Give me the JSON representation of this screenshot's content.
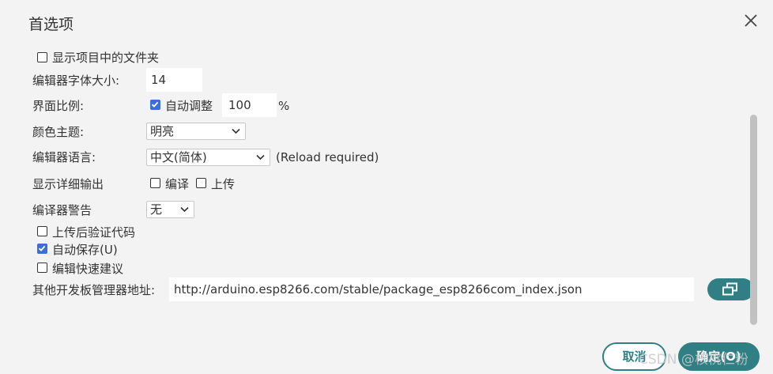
{
  "dialog": {
    "title": "首选项"
  },
  "settings": {
    "show_sketch_folder": {
      "label": "显示项目中的文件夹",
      "checked": false
    },
    "editor_font_size": {
      "label": "编辑器字体大小:",
      "value": "14"
    },
    "interface_scale": {
      "label": "界面比例:",
      "auto_label": "自动调整",
      "auto_checked": true,
      "value": "100",
      "unit": "%"
    },
    "theme": {
      "label": "颜色主题:",
      "value": "明亮"
    },
    "language": {
      "label": "编辑器语言:",
      "value": "中文(简体)",
      "note": "(Reload required)"
    },
    "verbose_output": {
      "label": "显示详细输出",
      "compile_label": "编译",
      "compile_checked": false,
      "upload_label": "上传",
      "upload_checked": false
    },
    "compiler_warnings": {
      "label": "编译器警告",
      "value": "无"
    },
    "verify_after_upload": {
      "label": "上传后验证代码",
      "checked": false
    },
    "auto_save": {
      "label": "自动保存(U)",
      "checked": true
    },
    "quick_suggestions": {
      "label": "编辑快速建议",
      "checked": false
    },
    "board_manager_urls": {
      "label": "其他开发板管理器地址:",
      "value": "http://arduino.esp8266.com/stable/package_esp8266com_index.json",
      "button_icon": "open-window-icon"
    }
  },
  "buttons": {
    "cancel": "取消",
    "ok": "确定(O)"
  },
  "watermark": "CSDN @核桃仁粉",
  "colors": {
    "accent": "#2f7f84",
    "checkbox": "#3b6fd6",
    "background": "#f3f3f3"
  }
}
